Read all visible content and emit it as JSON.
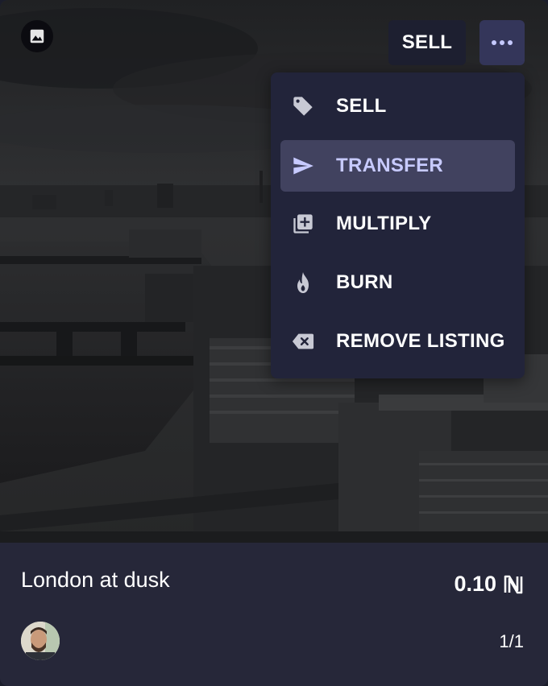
{
  "top_bar": {
    "media_icon": "image-icon",
    "sell_label": "SELL",
    "more_icon": "more-horizontal-icon"
  },
  "menu": {
    "items": [
      {
        "label": "SELL",
        "icon": "tag-icon",
        "active": false
      },
      {
        "label": "TRANSFER",
        "icon": "send-icon",
        "active": true
      },
      {
        "label": "MULTIPLY",
        "icon": "add-copy-icon",
        "active": false
      },
      {
        "label": "BURN",
        "icon": "flame-icon",
        "active": false
      },
      {
        "label": "REMOVE LISTING",
        "icon": "backspace-icon",
        "active": false
      }
    ]
  },
  "artwork": {
    "title": "London at dusk",
    "price": "0.10",
    "currency_icon": "near-logo-icon",
    "edition": "1/1",
    "owner_avatar": "avatar"
  },
  "colors": {
    "card_bg": "#252638",
    "menu_bg": "#22243a",
    "active_item_bg": "#41425f",
    "accent": "#c7caff"
  }
}
